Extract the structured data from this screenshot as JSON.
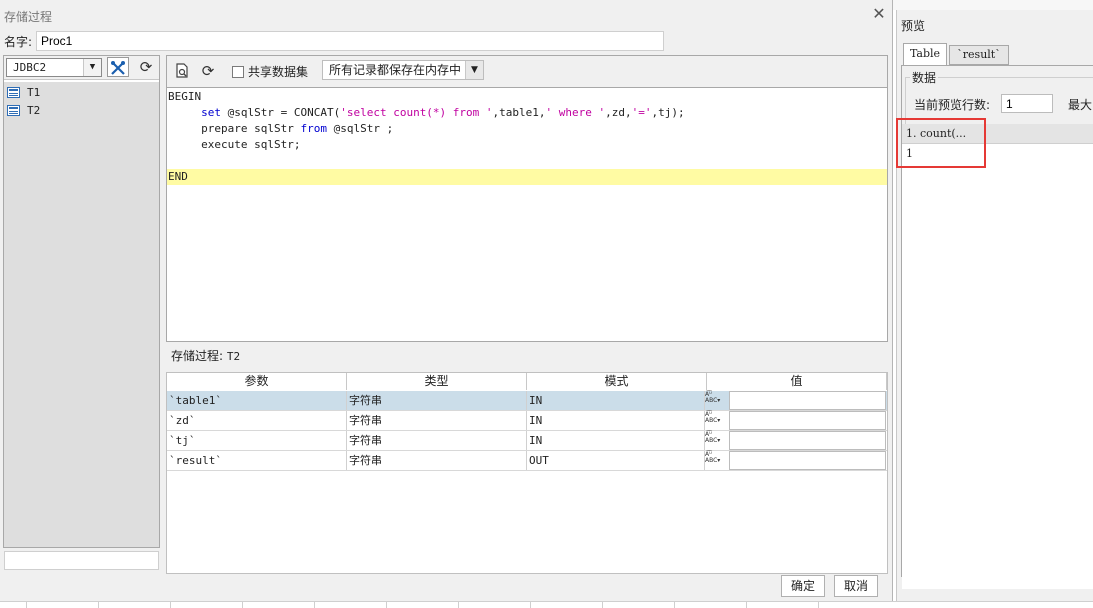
{
  "dialog": {
    "title": "存储过程",
    "name_label": "名字:",
    "name_value": "Proc1",
    "ok_label": "确定",
    "cancel_label": "取消"
  },
  "left": {
    "datasource": "JDBC2",
    "tree_items": [
      "T1",
      "T2"
    ]
  },
  "editor": {
    "share_label": "共享数据集",
    "memory_option": "所有记录都保存在内存中",
    "code": {
      "begin": "BEGIN",
      "line1_kw": "set",
      "line1_a": " @sqlStr = CONCAT(",
      "line1_s1": "'select count(*) from '",
      "line1_b": ",table1,",
      "line1_s2": "' where '",
      "line1_c": ",zd,",
      "line1_s3": "'='",
      "line1_d": ",tj);",
      "line2_a": "prepare sqlStr ",
      "line2_kw": "from",
      "line2_b": " @sqlStr ;",
      "line3": "execute sqlStr;",
      "end": "END"
    }
  },
  "params": {
    "proc_label": "存储过程:",
    "proc_name": "T2",
    "headers": [
      "参数",
      "类型",
      "模式",
      "值"
    ],
    "rows": [
      {
        "name": "`table1`",
        "type": "字符串",
        "mode": "IN"
      },
      {
        "name": "`zd`",
        "type": "字符串",
        "mode": "IN"
      },
      {
        "name": "`tj`",
        "type": "字符串",
        "mode": "IN"
      },
      {
        "name": "`result`",
        "type": "字符串",
        "mode": "OUT"
      }
    ]
  },
  "preview": {
    "title": "预览",
    "tabs": [
      "Table",
      "`result`"
    ],
    "data_label": "数据",
    "rows_label": "当前预览行数:",
    "rows_value": "1",
    "max_label": "最大的",
    "column_header": "1. count(...",
    "cell_value": "1"
  },
  "colors": {
    "highlight": "#fffba3",
    "keyword": "#0000d0",
    "string": "#c000a0",
    "selected_row": "#cbdde9",
    "red_box": "#e53935"
  },
  "icons": [
    "tools-icon",
    "refresh-icon",
    "preview-doc-icon",
    "table-icon",
    "abc-type-icon",
    "close-icon",
    "chevron-down-icon"
  ]
}
